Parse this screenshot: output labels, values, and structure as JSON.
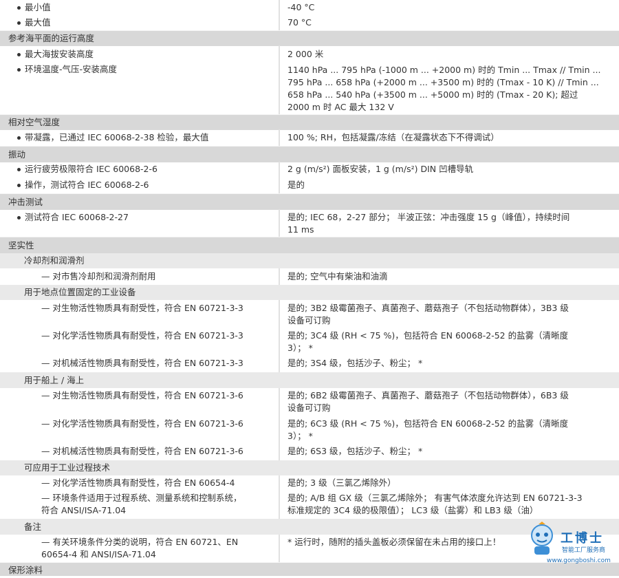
{
  "rows": {
    "min_label": "最小值",
    "min_value": "-40 °C",
    "max_label": "最大值",
    "max_value": "70 °C",
    "altitude_header": "参考海平面的运行高度",
    "alt_max_label": "最大海拔安装高度",
    "alt_max_value": "2 000 米",
    "alt_env_label": "环境温度-气压-安装高度",
    "alt_env_value": [
      "1140 hPa ... 795 hPa (-1000 m ... +2000 m) 时的 Tmin ... Tmax // Tmin ...",
      "795 hPa ... 658 hPa (+2000 m ... +3500 m) 时的 (Tmax - 10 K) // Tmin ...",
      "658 hPa ... 540 hPa (+3500 m ... +5000 m) 时的 (Tmax - 20 K);    超过",
      "2000 m 时 AC 最大 132 V"
    ],
    "humidity_header": "相对空气湿度",
    "humidity_label": "带凝露，已通过 IEC 60068-2-38 检验，最大值",
    "humidity_value": "100 %; RH，包括凝露/冻结（在凝露状态下不得调试）",
    "vibration_header": "振动",
    "vib_op_label": "运行疲劳极限符合 IEC 60068-2-6",
    "vib_op_value": "2 g (m/s²) 面板安装，1 g (m/s²) DIN 凹槽导轨",
    "vib_test_label": "操作，测试符合 IEC 60068-2-6",
    "vib_test_value": "是的",
    "shock_header": "冲击测试",
    "shock_label": "测试符合 IEC 60068-2-27",
    "shock_value": [
      "是的; IEC 68，2-27 部分；  半波正弦：冲击强度 15 g（峰值），持续时间",
      "11 ms"
    ],
    "robust_header": "坚实性",
    "coolant_sub": "冷却剂和润滑剂",
    "coolant_label": "— 对市售冷却剂和润滑剂耐用",
    "coolant_value": "是的; 空气中有柴油和油滴",
    "fixed_sub": "用于地点位置固定的工业设备",
    "fixed_bio_label": "— 对生物活性物质具有耐受性，符合 EN 60721-3-3",
    "fixed_bio_value": [
      "是的; 3B2 级霉菌孢子、真菌孢子、蘑菇孢子（不包括动物群体），3B3 级",
      "设备可订购"
    ],
    "fixed_chem_label": "— 对化学活性物质具有耐受性，符合 EN 60721-3-3",
    "fixed_chem_value": [
      "是的; 3C4 级 (RH < 75 %)，包括符合 EN 60068-2-52 的盐雾（清晰度",
      "3）；  *"
    ],
    "fixed_mech_label": "— 对机械活性物质具有耐受性，符合 EN 60721-3-3",
    "fixed_mech_value": "是的; 3S4 级，包括沙子、粉尘；  *",
    "ship_sub": "用于船上 / 海上",
    "ship_bio_label": "— 对生物活性物质具有耐受性，符合 EN 60721-3-6",
    "ship_bio_value": [
      "是的; 6B2 级霉菌孢子、真菌孢子、蘑菇孢子（不包括动物群体），6B3 级",
      "设备可订购"
    ],
    "ship_chem_label": "— 对化学活性物质具有耐受性，符合 EN 60721-3-6",
    "ship_chem_value": [
      "是的; 6C3 级 (RH < 75 %)，包括符合 EN 60068-2-52 的盐雾（清晰度",
      "3）；  *"
    ],
    "ship_mech_label": "— 对机械活性物质具有耐受性，符合 EN 60721-3-6",
    "ship_mech_value": "是的; 6S3 级，包括沙子、粉尘；  *",
    "process_sub": "可应用于工业过程技术",
    "proc_chem_label": "— 对化学活性物质具有耐受性，符合 EN 60654-4",
    "proc_chem_value": "是的; 3 级（三氯乙烯除外）",
    "proc_env_label": [
      "— 环境条件适用于过程系统、测量系统和控制系统，",
      "符合 ANSI/ISA-71.04"
    ],
    "proc_env_value": [
      "是的; A/B 组 GX 级（三氯乙烯除外；  有害气体浓度允许达到 EN 60721-3-3",
      "标准规定的 3C4 级的极限值）；  LC3 级（盐雾）和 LB3 级（油）"
    ],
    "note_sub": "备注",
    "note_label": [
      "— 有关环境条件分类的说明，符合 EN 60721、EN",
      "60654-4 和 ANSI/ISA-71.04"
    ],
    "note_value": "* 运行时，随附的插头盖板必须保留在未占用的接口上！",
    "coating_header": "保形涂料"
  },
  "watermark": {
    "brand": "工博士",
    "tagline": "智能工厂服务商",
    "url": "www.gongboshi.com"
  }
}
